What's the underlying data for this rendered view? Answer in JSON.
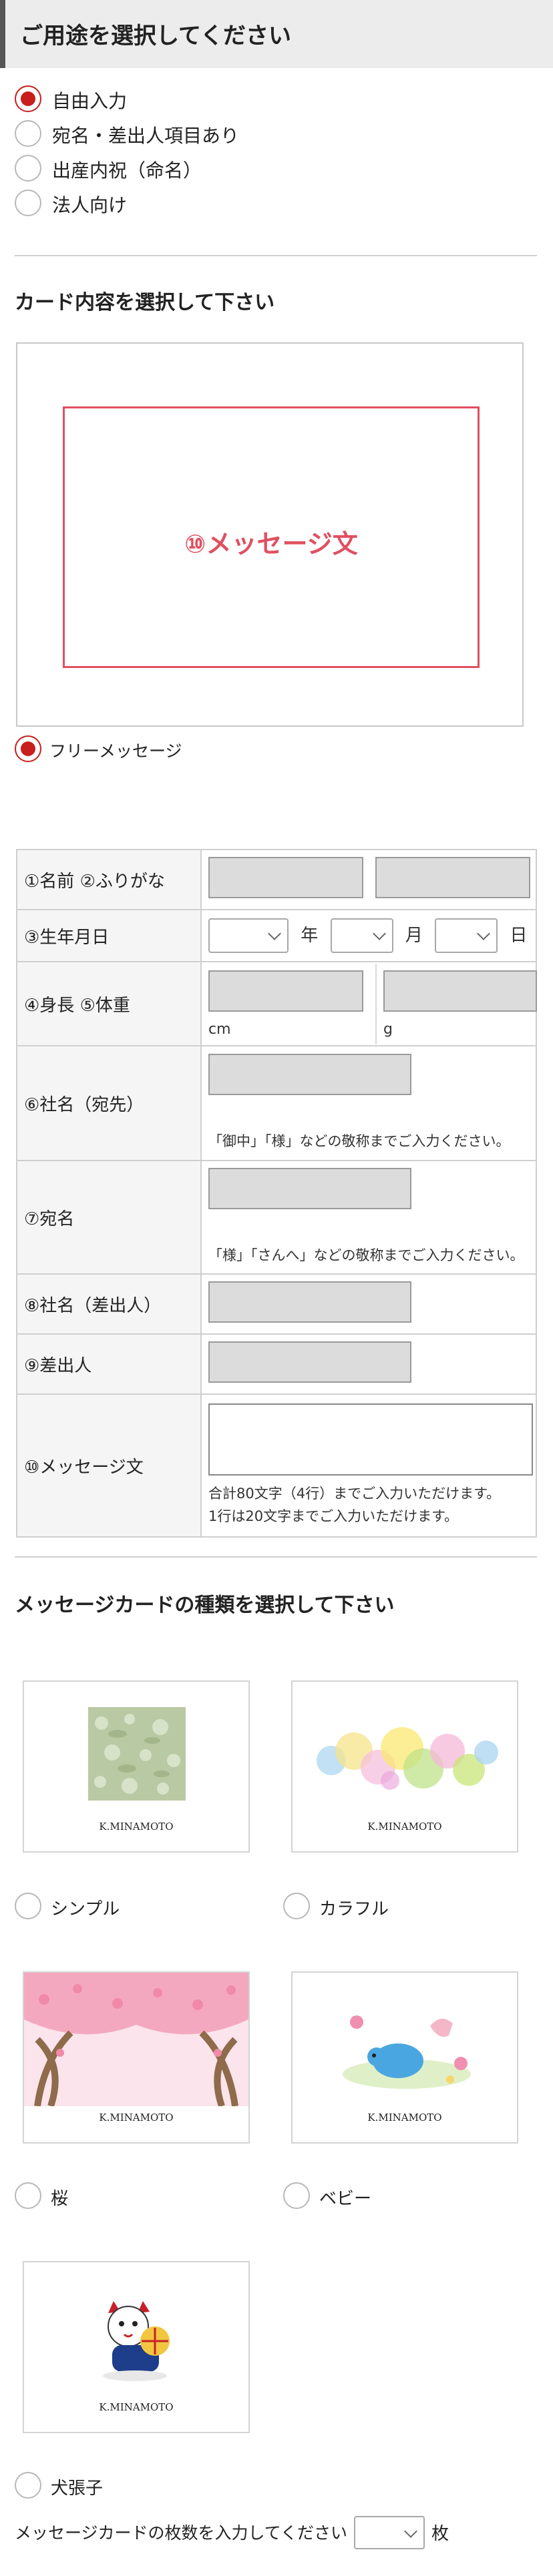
{
  "usage": {
    "title": "ご用途を選択してください",
    "options": [
      "自由入力",
      "宛名・差出人項目あり",
      "出産内祝（命名）",
      "法人向け"
    ],
    "selected": 0
  },
  "card_content": {
    "title": "カード内容を選択して下さい",
    "preview_text": "⑩メッセージ文",
    "option_label": "フリーメッセージ"
  },
  "form": {
    "name_label": "①名前 ②ふりがな",
    "birth_label": "③生年月日",
    "year": "年",
    "month": "月",
    "day": "日",
    "height_label": "④身長 ⑤体重",
    "cm": "cm",
    "g": "g",
    "company_label": "⑥社名（宛先）",
    "company_note": "「御中」「様」などの敬称までご入力ください。",
    "address_label": "⑦宛名",
    "address_note": "「様」「さんへ」などの敬称までご入力ください。",
    "sender_company_label": "⑧社名（差出人）",
    "sender_label": "⑨差出人",
    "message_label": "⑩メッセージ文",
    "message_note1": "合計80文字（4行）までご入力いただけます。",
    "message_note2": "1行は20文字までご入力いただけます。"
  },
  "card_type": {
    "title": "メッセージカードの種類を選択して下さい",
    "brand": "K.MINAMOTO",
    "options": [
      "シンプル",
      "カラフル",
      "桜",
      "ベビー",
      "犬張子"
    ]
  },
  "quantity": {
    "label": "メッセージカードの枚数を入力してください",
    "unit": "枚"
  },
  "colors": {
    "accent": "#c81e1e",
    "preview_red": "#e05060"
  }
}
